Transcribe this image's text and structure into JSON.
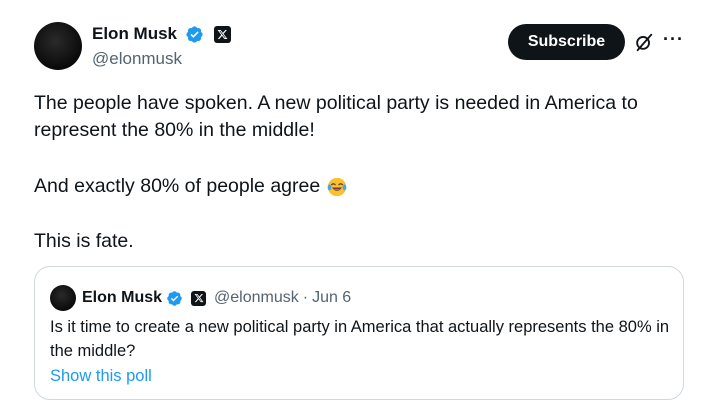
{
  "author": {
    "display_name": "Elon Musk",
    "handle": "@elonmusk"
  },
  "actions": {
    "subscribe_label": "Subscribe",
    "more_label": "···"
  },
  "tweet": {
    "paragraphs": [
      "The people have spoken. A new political party is needed in America to represent the 80% in the middle!",
      "And exactly 80% of people agree",
      "This is fate."
    ],
    "emoji": "face-with-tears-of-joy"
  },
  "quote": {
    "display_name": "Elon Musk",
    "handle": "@elonmusk",
    "separator": "·",
    "date": "Jun 6",
    "text": "Is it time to create a new political party in America that actually represents the 80% in the middle?",
    "poll_link": "Show this poll"
  },
  "colors": {
    "verified_blue": "#1d9bf0",
    "text_primary": "#0f1419",
    "text_secondary": "#536471",
    "link": "#1d9bf0",
    "border": "#cfd9de"
  },
  "icons": [
    "verified-badge-icon",
    "x-affiliate-icon",
    "grok-icon",
    "more-icon",
    "laughing-emoji-icon"
  ]
}
